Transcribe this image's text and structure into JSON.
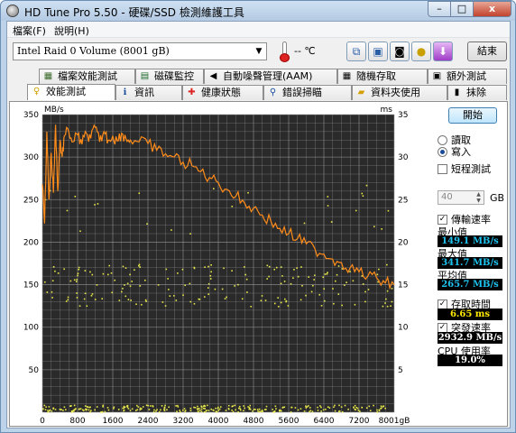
{
  "window": {
    "title": "HD Tune Pro 5.50 - 硬碟/SSD 檢測維護工具",
    "min_glyph": "–",
    "max_glyph": "□",
    "close_glyph": "x"
  },
  "menu": {
    "file": "檔案(F)",
    "help": "說明(H)"
  },
  "toolbar": {
    "drive": "Intel  Raid 0 Volume (8001 gB)",
    "temperature": "-- ℃",
    "icons": [
      "copy-icon",
      "save-icon",
      "camera-icon",
      "coins-icon",
      "download-icon"
    ],
    "exit_label": "結束"
  },
  "tabs": {
    "top": [
      {
        "label": "檔案效能測試",
        "icon": "file-benchmark-icon"
      },
      {
        "label": "磁碟監控",
        "icon": "disk-monitor-icon"
      },
      {
        "label": "自動噪聲管理(AAM)",
        "icon": "speaker-icon"
      },
      {
        "label": "隨機存取",
        "icon": "random-access-icon"
      },
      {
        "label": "額外測試",
        "icon": "extra-tests-icon"
      }
    ],
    "bottom": [
      {
        "label": "效能測試",
        "icon": "benchmark-icon"
      },
      {
        "label": "資訊",
        "icon": "info-icon"
      },
      {
        "label": "健康狀態",
        "icon": "health-icon"
      },
      {
        "label": "錯誤掃瞄",
        "icon": "error-scan-icon"
      },
      {
        "label": "資料夾使用",
        "icon": "folder-usage-icon"
      },
      {
        "label": "抹除",
        "icon": "erase-icon"
      }
    ],
    "active": "效能測試"
  },
  "side": {
    "start_label": "開始",
    "read_label": "讀取",
    "write_label": "寫入",
    "mode": "write",
    "short_test_label": "短程測試",
    "short_test_checked": false,
    "gb_value": "40",
    "gb_unit": "GB",
    "transfer_label": "傳輸速率",
    "transfer_checked": true,
    "min_label": "最小值",
    "min_value": "149.1 MB/s",
    "max_label": "最大值",
    "max_value": "341.7 MB/s",
    "avg_label": "平均值",
    "avg_value": "265.7 MB/s",
    "access_label": "存取時間",
    "access_checked": true,
    "access_value": "6.65 ms",
    "burst_label": "突發速率",
    "burst_checked": true,
    "burst_value": "2932.9 MB/s",
    "cpu_label": "CPU 使用率",
    "cpu_value": "19.0%"
  },
  "chart_data": {
    "type": "line",
    "ylabel": "MB/s",
    "y2label": "ms",
    "x_unit": "gB",
    "xlim": [
      0,
      8001
    ],
    "ylim": [
      0,
      350
    ],
    "y2lim": [
      0,
      35
    ],
    "x_ticks": [
      "0",
      "800",
      "1600",
      "2400",
      "3200",
      "4000",
      "4800",
      "5600",
      "6400",
      "7200",
      "8001gB"
    ],
    "y_ticks": [
      "350",
      "300",
      "250",
      "200",
      "150",
      "100",
      "50"
    ],
    "y2_ticks": [
      "35",
      "30",
      "25",
      "20",
      "15",
      "10",
      "5"
    ],
    "grid": true,
    "colors": {
      "background": "#2a2a2a",
      "grid": "#9a9a9a",
      "line": "#ff8c1a",
      "points": "#e8e84a"
    },
    "series": [
      {
        "kind": "transfer_rate",
        "x": [
          0,
          50,
          100,
          150,
          200,
          250,
          300,
          350,
          400,
          450,
          500,
          600,
          700,
          800,
          900,
          1000,
          1100,
          1200,
          1300,
          1400,
          1500,
          1600,
          1700,
          1800,
          1900,
          2000,
          2200,
          2400,
          2600,
          2800,
          3000,
          3200,
          3400,
          3600,
          3800,
          4000,
          4200,
          4400,
          4600,
          4800,
          5000,
          5200,
          5400,
          5600,
          5800,
          6000,
          6200,
          6400,
          6600,
          6800,
          7000,
          7200,
          7400,
          7600,
          7800,
          8001
        ],
        "values": [
          268,
          222,
          330,
          250,
          305,
          258,
          338,
          260,
          320,
          300,
          325,
          330,
          318,
          326,
          315,
          328,
          322,
          335,
          318,
          330,
          320,
          325,
          319,
          328,
          322,
          320,
          318,
          316,
          308,
          304,
          300,
          294,
          290,
          283,
          276,
          270,
          262,
          254,
          246,
          240,
          232,
          224,
          216,
          210,
          204,
          198,
          192,
          186,
          180,
          176,
          170,
          165,
          160,
          158,
          152,
          150
        ]
      },
      {
        "kind": "access_time_bands_ms",
        "bands": [
          {
            "center": 0.5,
            "spread": 0.4,
            "count": 260
          },
          {
            "center": 15,
            "spread": 2.5,
            "count": 180
          },
          {
            "center": 24,
            "spread": 3,
            "count": 25
          }
        ]
      }
    ]
  }
}
